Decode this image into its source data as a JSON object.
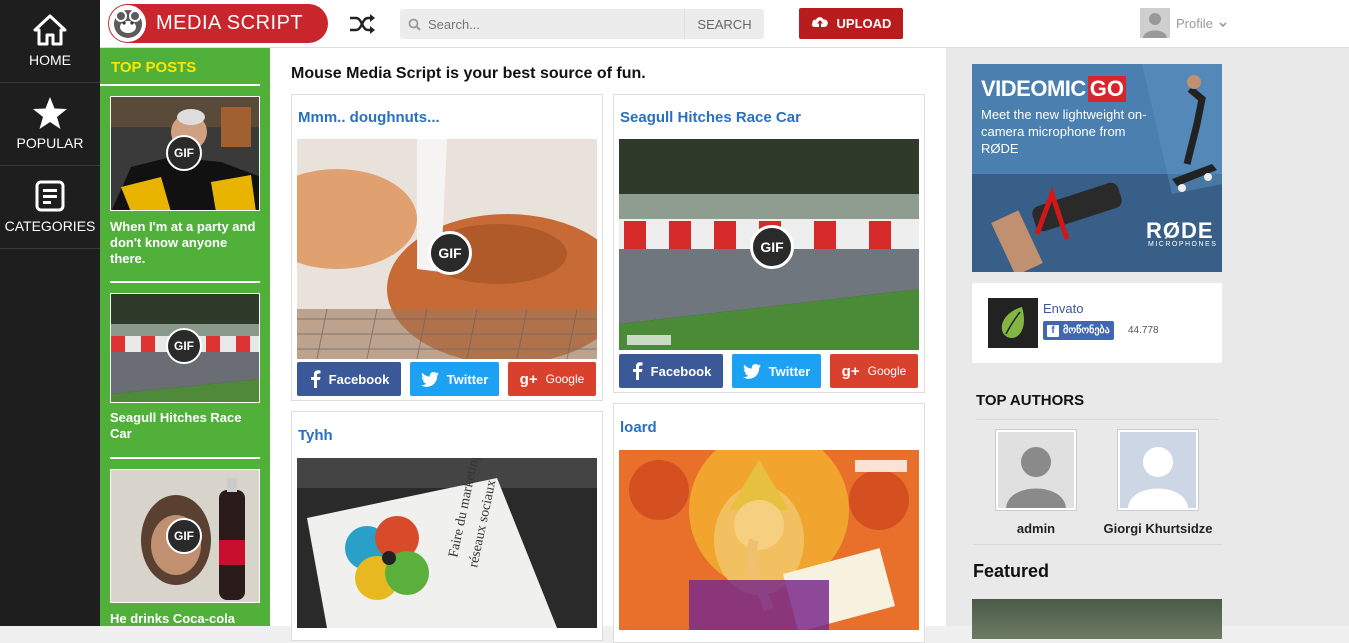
{
  "nav": {
    "items": [
      {
        "label": "HOME",
        "icon": "home-icon"
      },
      {
        "label": "POPULAR",
        "icon": "star-icon"
      },
      {
        "label": "CATEGORIES",
        "icon": "categories-icon"
      }
    ]
  },
  "header": {
    "logo_text": "MEDIA SCRIPT",
    "search_placeholder": "Search...",
    "search_button": "SEARCH",
    "upload_label": "UPLOAD",
    "profile_label": "Profile"
  },
  "top_posts": {
    "title": "TOP POSTS",
    "items": [
      {
        "caption": "When I'm at a party and don't know anyone there.",
        "badge": "GIF"
      },
      {
        "caption": "Seagull Hitches Race Car",
        "badge": "GIF"
      },
      {
        "caption": "He drinks Coca-cola",
        "badge": "GIF"
      }
    ]
  },
  "main": {
    "title": "Mouse Media Script is your best source of fun.",
    "cards": [
      {
        "title": "Mmm.. doughnuts...",
        "badge": "GIF"
      },
      {
        "title": "Seagull Hitches Race Car",
        "badge": "GIF"
      },
      {
        "title": "Tyhh"
      },
      {
        "title": "loard"
      }
    ],
    "share": {
      "facebook": "Facebook",
      "twitter": "Twitter",
      "google": "Google"
    }
  },
  "sidebar": {
    "ad": {
      "brand": "VIDEOMIC",
      "brand_accent": "GO",
      "tagline": "Meet the new lightweight on-camera microphone from RØDE",
      "maker": "RØDE",
      "maker_sub": "MICROPHONES"
    },
    "envato": {
      "name": "Envato",
      "like_label": "მოწონება",
      "count": "44.778"
    },
    "authors_title": "TOP AUTHORS",
    "authors": [
      {
        "name": "admin"
      },
      {
        "name": "Giorgi Khurtsidze"
      }
    ],
    "featured_title": "Featured"
  },
  "colors": {
    "brand_red": "#c9252c",
    "upload_red": "#b81c1c",
    "green": "#50b03a",
    "link_blue": "#2a70c2",
    "facebook": "#3b5998",
    "twitter": "#1da1f2",
    "google": "#d9412c"
  }
}
